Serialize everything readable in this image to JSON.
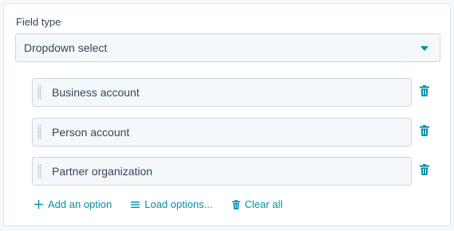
{
  "field_type": {
    "label": "Field type",
    "selected": "Dropdown select"
  },
  "options": [
    {
      "label": "Business account"
    },
    {
      "label": "Person account"
    },
    {
      "label": "Partner organization"
    }
  ],
  "actions": {
    "add_option": "Add an option",
    "load_options": "Load options...",
    "clear_all": "Clear all"
  },
  "colors": {
    "accent": "#0091ae",
    "text": "#33475b",
    "input_bg": "#f5f8fa",
    "border": "#cbd6e2"
  },
  "icons": [
    "chevron-down-icon",
    "drag-handle-icon",
    "trash-icon",
    "plus-icon",
    "list-icon"
  ]
}
